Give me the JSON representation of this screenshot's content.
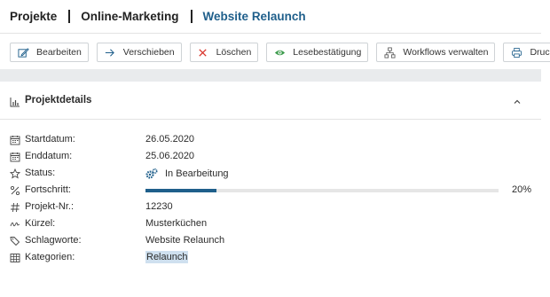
{
  "breadcrumb": {
    "items": [
      "Projekte",
      "Online-Marketing",
      "Website Relaunch"
    ]
  },
  "toolbar": {
    "buttons": [
      {
        "label": "Bearbeiten",
        "icon": "edit-icon"
      },
      {
        "label": "Verschieben",
        "icon": "arrow-right-icon"
      },
      {
        "label": "Löschen",
        "icon": "close-icon"
      },
      {
        "label": "Lesebestätigung",
        "icon": "eye-icon"
      },
      {
        "label": "Workflows verwalten",
        "icon": "workflow-icon"
      },
      {
        "label": "Drucken",
        "icon": "printer-icon"
      }
    ]
  },
  "panel": {
    "title": "Projektdetails",
    "icon": "chart-icon",
    "collapse_icon": "chevron-up-icon"
  },
  "details": {
    "startdatum": {
      "label": "Startdatum:",
      "value": "26.05.2020",
      "icon": "calendar-icon"
    },
    "enddatum": {
      "label": "Enddatum:",
      "value": "25.06.2020",
      "icon": "calendar-icon"
    },
    "status": {
      "label": "Status:",
      "value": "In Bearbeitung",
      "icon": "star-icon",
      "value_icon": "gears-icon"
    },
    "fortschritt": {
      "label": "Fortschritt:",
      "percent_text": "20%",
      "percent": 20,
      "icon": "percent-icon"
    },
    "projektnr": {
      "label": "Projekt-Nr.:",
      "value": "12230",
      "icon": "hash-icon"
    },
    "kuerzel": {
      "label": "Kürzel:",
      "value": "Musterküchen",
      "icon": "signature-icon"
    },
    "schlagworte": {
      "label": "Schlagworte:",
      "value": "Website Relaunch",
      "icon": "tags-icon"
    },
    "kategorien": {
      "label": "Kategorien:",
      "value": "Relaunch",
      "icon": "grid-icon"
    }
  },
  "colors": {
    "accent": "#1f5f8b",
    "tag_background": "#cfe0ef",
    "delete_red": "#d9342b",
    "eye_green": "#3a9a4a"
  }
}
